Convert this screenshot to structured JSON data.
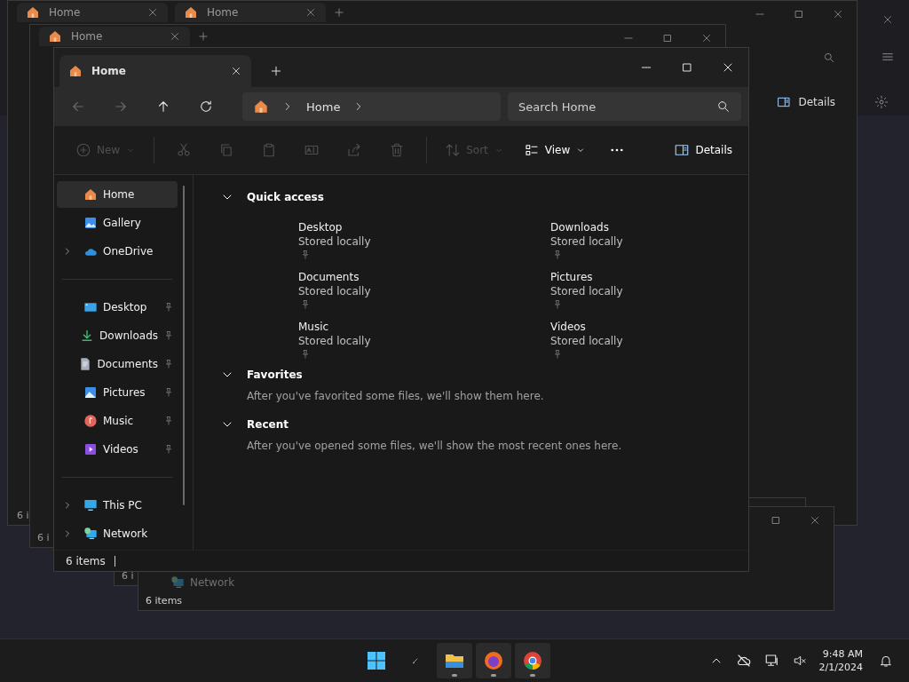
{
  "background_windows": [
    {
      "tabs": [
        "Home",
        "Home"
      ],
      "details": "Details",
      "status": "6 i"
    },
    {
      "tabs": [
        "Home"
      ],
      "status": "6 i"
    },
    {
      "status": "6 i"
    },
    {
      "nav_item": "Network",
      "status": "6 items"
    }
  ],
  "window": {
    "tabs": [
      {
        "title": "Home",
        "selected": true
      }
    ],
    "address": {
      "crumbs": [
        "Home"
      ]
    },
    "search": {
      "placeholder": "Search Home"
    },
    "toolbar": [
      {
        "kind": "new",
        "label": "New",
        "disabled": true,
        "dropdown": true
      },
      {
        "kind": "cut",
        "disabled": true
      },
      {
        "kind": "copy",
        "disabled": true
      },
      {
        "kind": "paste",
        "disabled": true
      },
      {
        "kind": "rename",
        "disabled": true
      },
      {
        "kind": "share",
        "disabled": true
      },
      {
        "kind": "trash",
        "disabled": true
      },
      {
        "kind": "sort",
        "label": "Sort",
        "disabled": true,
        "dropdown": true
      },
      {
        "kind": "view",
        "label": "View",
        "disabled": false,
        "dropdown": true
      },
      {
        "kind": "more",
        "disabled": false
      }
    ],
    "details_button": "Details",
    "sidebar": {
      "groups": [
        [
          {
            "label": "Home",
            "kind": "home",
            "selected": true,
            "expandable": false,
            "pinned": false
          },
          {
            "label": "Gallery",
            "kind": "gallery",
            "selected": false,
            "expandable": false,
            "pinned": false
          },
          {
            "label": "OneDrive",
            "kind": "cloud",
            "selected": false,
            "expandable": true,
            "pinned": false
          }
        ],
        [
          {
            "label": "Desktop",
            "kind": "desktop",
            "selected": false,
            "expandable": false,
            "pinned": true
          },
          {
            "label": "Downloads",
            "kind": "download",
            "selected": false,
            "expandable": false,
            "pinned": true
          },
          {
            "label": "Documents",
            "kind": "document",
            "selected": false,
            "expandable": false,
            "pinned": true
          },
          {
            "label": "Pictures",
            "kind": "pictures",
            "selected": false,
            "expandable": false,
            "pinned": true
          },
          {
            "label": "Music",
            "kind": "music",
            "selected": false,
            "expandable": false,
            "pinned": true
          },
          {
            "label": "Videos",
            "kind": "videos",
            "selected": false,
            "expandable": false,
            "pinned": true
          }
        ],
        [
          {
            "label": "This PC",
            "kind": "pc",
            "selected": false,
            "expandable": true,
            "pinned": false
          },
          {
            "label": "Network",
            "kind": "network",
            "selected": false,
            "expandable": true,
            "pinned": false
          }
        ]
      ]
    },
    "sections": [
      {
        "title": "Quick access",
        "expanded": true,
        "items": [
          {
            "name": "Desktop",
            "subtitle": "Stored locally",
            "pinned": true
          },
          {
            "name": "Downloads",
            "subtitle": "Stored locally",
            "pinned": true
          },
          {
            "name": "Documents",
            "subtitle": "Stored locally",
            "pinned": true
          },
          {
            "name": "Pictures",
            "subtitle": "Stored locally",
            "pinned": true
          },
          {
            "name": "Music",
            "subtitle": "Stored locally",
            "pinned": true
          },
          {
            "name": "Videos",
            "subtitle": "Stored locally",
            "pinned": true
          }
        ]
      },
      {
        "title": "Favorites",
        "expanded": true,
        "message": "After you've favorited some files, we'll show them here."
      },
      {
        "title": "Recent",
        "expanded": true,
        "message": "After you've opened some files, we'll show the most recent ones here."
      }
    ],
    "status_bar": "6 items"
  },
  "taskbar": {
    "apps": [
      {
        "kind": "start",
        "running": false
      },
      {
        "kind": "pen",
        "running": false
      },
      {
        "kind": "explorer",
        "running": true
      },
      {
        "kind": "firefox",
        "running": true
      },
      {
        "kind": "chrome",
        "running": true
      }
    ],
    "time": "9:48 AM",
    "date": "2/1/2024"
  }
}
